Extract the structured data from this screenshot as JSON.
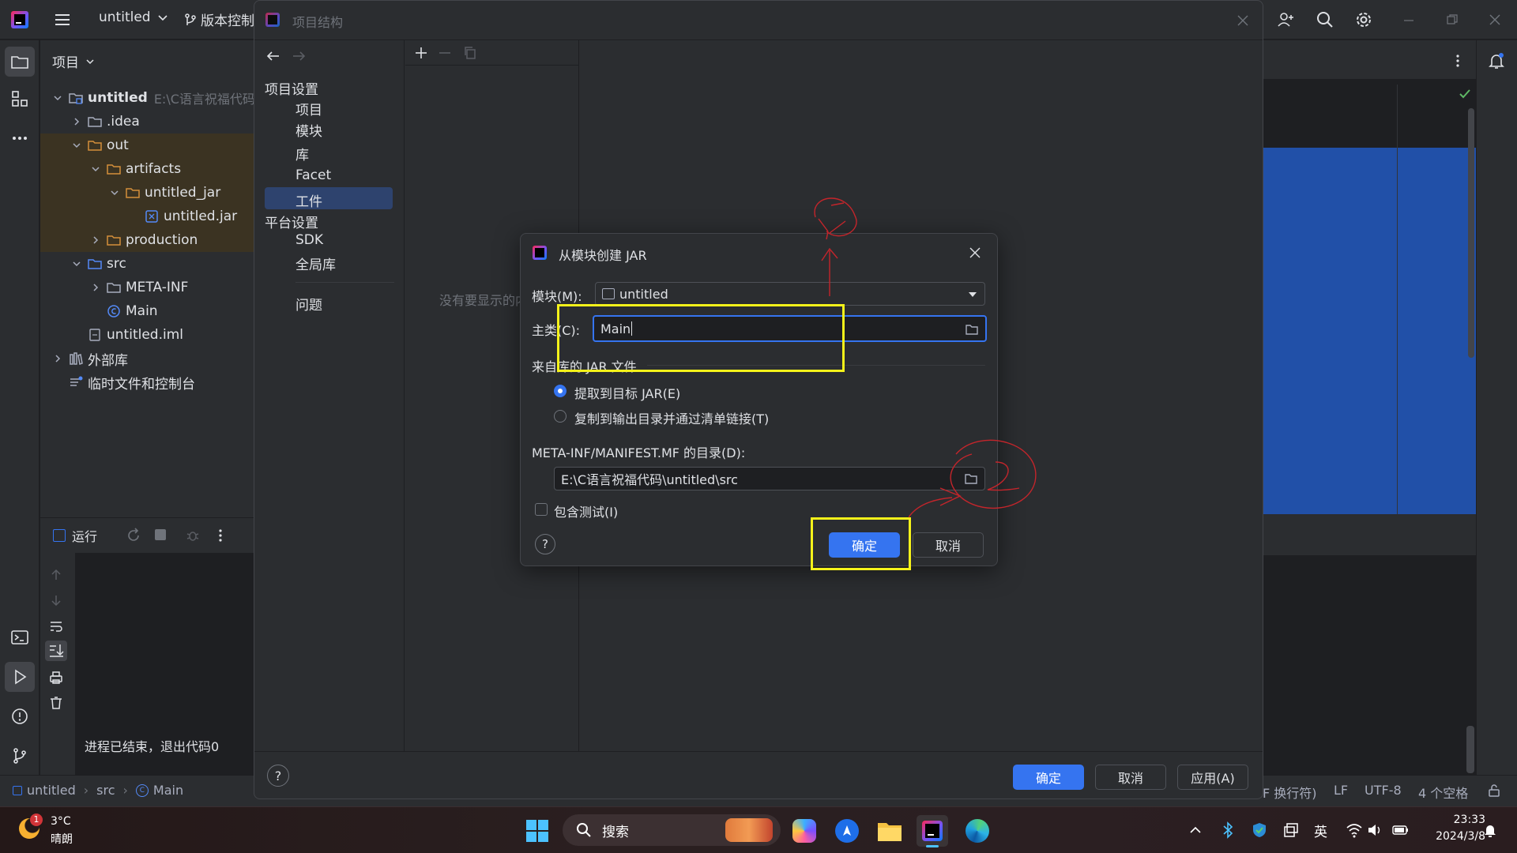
{
  "titlebar": {
    "project_name": "untitled",
    "vcs_label": "版本控制"
  },
  "project_panel": {
    "title": "项目",
    "tree": [
      {
        "label": "untitled",
        "extra": "E:\\C语言祝福代码",
        "depth": 0,
        "expanded": true,
        "kind": "module-folder"
      },
      {
        "label": ".idea",
        "depth": 1,
        "expanded": false,
        "kind": "folder"
      },
      {
        "label": "out",
        "depth": 1,
        "expanded": true,
        "kind": "excluded-folder"
      },
      {
        "label": "artifacts",
        "depth": 2,
        "expanded": true,
        "kind": "excluded-folder"
      },
      {
        "label": "untitled_jar",
        "depth": 3,
        "expanded": true,
        "kind": "excluded-folder"
      },
      {
        "label": "untitled.jar",
        "depth": 4,
        "kind": "jar"
      },
      {
        "label": "production",
        "depth": 2,
        "expanded": false,
        "kind": "excluded-folder"
      },
      {
        "label": "src",
        "depth": 1,
        "expanded": true,
        "kind": "source-folder"
      },
      {
        "label": "META-INF",
        "depth": 2,
        "expanded": false,
        "kind": "folder"
      },
      {
        "label": "Main",
        "depth": 2,
        "kind": "class"
      },
      {
        "label": "untitled.iml",
        "depth": 1,
        "kind": "iml"
      },
      {
        "label": "外部库",
        "depth": 0,
        "expanded": false,
        "kind": "library"
      },
      {
        "label": "临时文件和控制台",
        "depth": 0,
        "kind": "scratch"
      }
    ]
  },
  "run_panel": {
    "title": "运行",
    "console_text": "进程已结束，退出代码0"
  },
  "statusbar": {
    "crumbs": [
      "untitled",
      "src",
      "Main"
    ],
    "right": [
      "(LF 换行符)",
      "LF",
      "UTF-8",
      "4 个空格"
    ],
    "right_display": [
      "F 换行符)",
      "LF",
      "UTF-8",
      "4 个空格"
    ]
  },
  "project_structure": {
    "title": "项目结构",
    "section_project": "项目设置",
    "items_project": [
      "项目",
      "模块",
      "库",
      "Facet",
      "工件"
    ],
    "selected": "工件",
    "section_platform": "平台设置",
    "items_platform": [
      "SDK",
      "全局库"
    ],
    "problems": "问题",
    "empty_text": "没有要显示的内容",
    "empty_text_visible": "没有要显示的内",
    "ok": "确定",
    "cancel": "取消",
    "apply": "应用(A)"
  },
  "jar_dialog": {
    "title": "从模块创建 JAR",
    "module_label": "模块(M):",
    "module_value": "untitled",
    "main_class_label": "主类(C):",
    "main_class_value": "Main",
    "jar_section": "来自库的 JAR 文件",
    "radio_extract": "提取到目标 JAR(E)",
    "radio_copy": "复制到输出目录并通过清单链接(T)",
    "radio_selected": "extract",
    "manifest_label": "META-INF/MANIFEST.MF 的目录(D):",
    "manifest_value": "E:\\C语言祝福代码\\untitled\\src",
    "include_tests": "包含测试(I)",
    "include_tests_checked": false,
    "ok": "确定",
    "cancel": "取消",
    "help": "?"
  },
  "taskbar": {
    "weather_temp": "3°C",
    "weather_desc": "晴朗",
    "weather_badge": "1",
    "search_placeholder": "搜索",
    "ime": "英",
    "time": "23:33",
    "date": "2024/3/8"
  },
  "colors": {
    "accent": "#3574f0",
    "highlight": "#f5f21a",
    "selection": "#2e436e",
    "excluded_bg": "#3b3322",
    "annotation": "#c4252b"
  }
}
